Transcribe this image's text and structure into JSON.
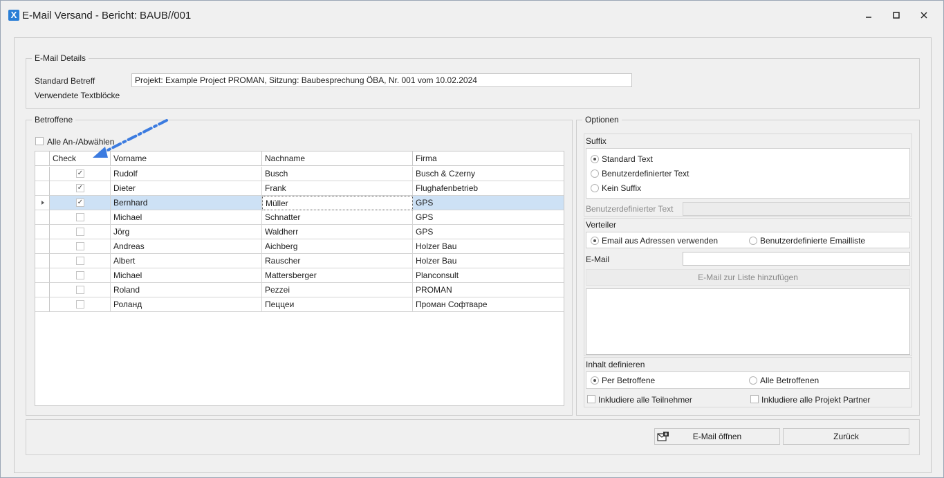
{
  "window": {
    "app_icon": "X",
    "title": "E-Mail Versand - Bericht: BAUB//001",
    "minimize": "🗕",
    "maximize": "🗖",
    "close": "✕"
  },
  "details": {
    "group_title": "E-Mail Details",
    "subject_label": "Standard Betreff",
    "subject_value": "Projekt: Example Project PROMAN, Sitzung: Baubesprechung ÖBA, Nr. 001 vom 10.02.2024",
    "textblocks_label": "Verwendete Textblöcke"
  },
  "betroffene": {
    "group_title": "Betroffene",
    "select_all_label": "Alle An-/Abwählen",
    "columns": [
      "Check",
      "Vorname",
      "Nachname",
      "Firma"
    ],
    "rows": [
      {
        "check": "✓",
        "vorname": "Rudolf",
        "nachname": "Busch",
        "firma": "Busch & Czerny"
      },
      {
        "check": "✓",
        "vorname": "Dieter",
        "nachname": "Frank",
        "firma": "Flughafenbetrieb"
      },
      {
        "check": "✓",
        "vorname": "Bernhard",
        "nachname": "Müller",
        "firma": "GPS"
      },
      {
        "check": "",
        "vorname": "Michael",
        "nachname": "Schnatter",
        "firma": "GPS"
      },
      {
        "check": "",
        "vorname": "Jörg",
        "nachname": "Waldherr",
        "firma": "GPS"
      },
      {
        "check": "",
        "vorname": "Andreas",
        "nachname": "Aichberg",
        "firma": "Holzer Bau"
      },
      {
        "check": "",
        "vorname": "Albert",
        "nachname": "Rauscher",
        "firma": "Holzer Bau"
      },
      {
        "check": "",
        "vorname": "Michael",
        "nachname": "Mattersberger",
        "firma": "Planconsult"
      },
      {
        "check": "",
        "vorname": "Roland",
        "nachname": "Pezzei",
        "firma": "PROMAN"
      },
      {
        "check": "",
        "vorname": "Роланд",
        "nachname": "Пеццеи",
        "firma": "Проман Софтваре"
      }
    ]
  },
  "options": {
    "group_title": "Optionen",
    "suffix": {
      "title": "Suffix",
      "choices": [
        "Standard Text",
        "Benutzerdefinierter Text",
        "Kein Suffix"
      ],
      "selected": "Standard Text",
      "custom_label": "Benutzerdefinierter Text",
      "custom_value": ""
    },
    "verteiler": {
      "title": "Verteiler",
      "choices": [
        "Email aus Adressen verwenden",
        "Benutzerdefinierte Emailliste"
      ],
      "selected": "Email aus Adressen verwenden",
      "email_label": "E-Mail",
      "email_value": "",
      "add_button": "E-Mail zur Liste hinzufügen"
    },
    "inhalt": {
      "title": "Inhalt definieren",
      "choices": [
        "Per Betroffene",
        "Alle Betroffenen"
      ],
      "selected": "Per Betroffene",
      "include_participants": "Inkludiere alle Teilnehmer",
      "include_partners": "Inkludiere alle Projekt Partner"
    }
  },
  "footer": {
    "open_mail": "E-Mail öffnen",
    "back": "Zurück"
  },
  "colors": {
    "selected_row": "#cde1f5",
    "annotation_arrow": "#3b7be0"
  }
}
